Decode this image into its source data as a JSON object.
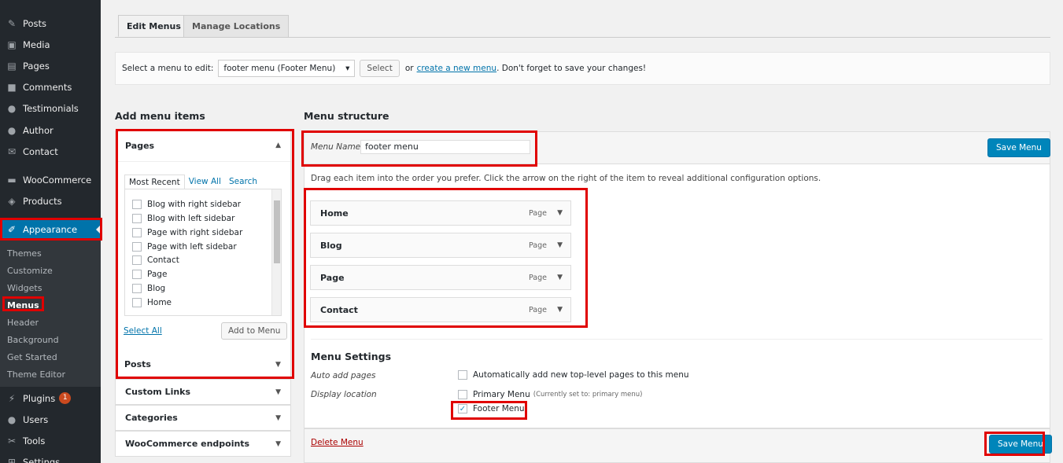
{
  "sidebar": {
    "items": [
      {
        "label": "Posts",
        "icon": "pin-icon"
      },
      {
        "label": "Media",
        "icon": "media-icon"
      },
      {
        "label": "Pages",
        "icon": "pages-icon"
      },
      {
        "label": "Comments",
        "icon": "comments-icon"
      },
      {
        "label": "Testimonials",
        "icon": "user-icon"
      },
      {
        "label": "Author",
        "icon": "user-icon"
      },
      {
        "label": "Contact",
        "icon": "mail-icon"
      },
      {
        "label": "WooCommerce",
        "icon": "woo-icon"
      },
      {
        "label": "Products",
        "icon": "box-icon"
      },
      {
        "label": "Appearance",
        "icon": "brush-icon"
      },
      {
        "label": "Plugins",
        "icon": "plug-icon",
        "badge": "1"
      },
      {
        "label": "Users",
        "icon": "user-icon"
      },
      {
        "label": "Tools",
        "icon": "wrench-icon"
      },
      {
        "label": "Settings",
        "icon": "settings-icon"
      }
    ],
    "submenu": [
      "Themes",
      "Customize",
      "Widgets",
      "Menus",
      "Header",
      "Background",
      "Get Started",
      "Theme Editor"
    ]
  },
  "tabs": {
    "edit": "Edit Menus",
    "locations": "Manage Locations"
  },
  "manage": {
    "prefix": "Select a menu to edit:",
    "selected": "footer menu (Footer Menu)",
    "select_btn": "Select",
    "or": "or",
    "create_link": "create a new menu",
    "suffix": ". Don't forget to save your changes!"
  },
  "add_items": {
    "title": "Add menu items",
    "pages_title": "Pages",
    "tabs": [
      "Most Recent",
      "View All",
      "Search"
    ],
    "pages": [
      "Blog with right sidebar",
      "Blog with left sidebar",
      "Page with right sidebar",
      "Page with left sidebar",
      "Contact",
      "Page",
      "Blog",
      "Home"
    ],
    "select_all": "Select All",
    "add_btn": "Add to Menu",
    "posts": "Posts",
    "custom_links": "Custom Links",
    "categories": "Categories",
    "woo_endpoints": "WooCommerce endpoints"
  },
  "structure": {
    "title": "Menu structure",
    "name_label": "Menu Name",
    "name_value": "footer menu",
    "save_btn": "Save Menu",
    "instructions": "Drag each item into the order you prefer. Click the arrow on the right of the item to reveal additional configuration options.",
    "items": [
      {
        "label": "Home",
        "type": "Page"
      },
      {
        "label": "Blog",
        "type": "Page"
      },
      {
        "label": "Page",
        "type": "Page"
      },
      {
        "label": "Contact",
        "type": "Page"
      }
    ],
    "settings_title": "Menu Settings",
    "auto_add_label": "Auto add pages",
    "auto_add_text": "Automatically add new top-level pages to this menu",
    "display_label": "Display location",
    "primary": "Primary Menu",
    "primary_note": "(Currently set to: primary menu)",
    "footer": "Footer Menu",
    "delete": "Delete Menu"
  }
}
